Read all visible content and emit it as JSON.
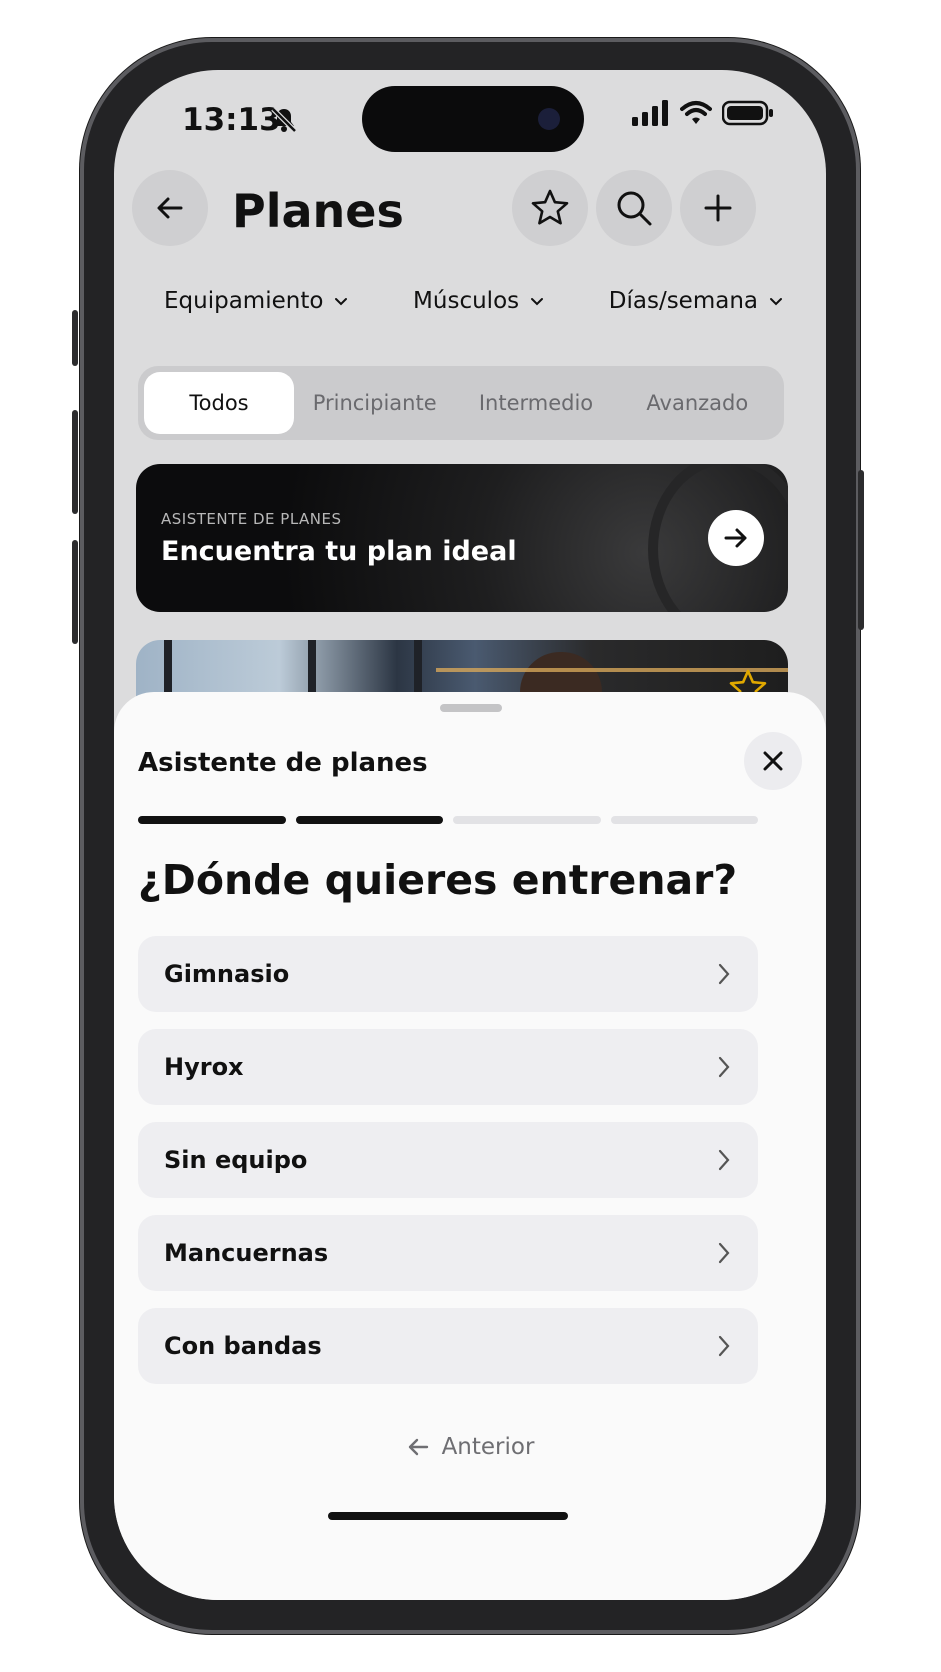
{
  "status_bar": {
    "time": "13:13"
  },
  "header": {
    "title": "Planes"
  },
  "filters": [
    {
      "label": "Equipamiento"
    },
    {
      "label": "Músculos"
    },
    {
      "label": "Días/semana"
    }
  ],
  "levels": {
    "selected": "Todos",
    "items": [
      "Todos",
      "Principiante",
      "Intermedio",
      "Avanzado"
    ]
  },
  "banner": {
    "kicker": "ASISTENTE DE PLANES",
    "title": "Encuentra tu plan ideal"
  },
  "sheet": {
    "title": "Asistente de planes",
    "progress": {
      "completed_steps": 2,
      "total_steps": 4
    },
    "question": "¿Dónde quieres entrenar?",
    "options": [
      "Gimnasio",
      "Hyrox",
      "Sin equipo",
      "Mancuernas",
      "Con bandas"
    ],
    "previous_label": "Anterior"
  },
  "colors": {
    "accent_dark": "#111111",
    "option_bg": "#eeeef1",
    "star": "#e0a800"
  }
}
